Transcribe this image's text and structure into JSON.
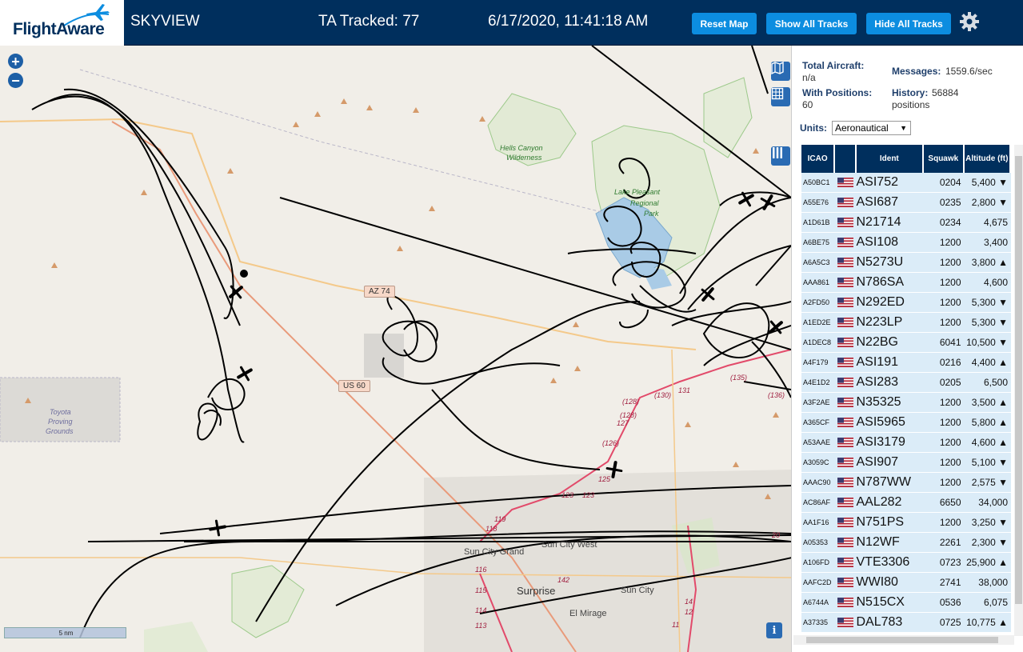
{
  "header": {
    "logo_text": "FlightAware",
    "app_title": "SKYVIEW",
    "tracked": "TA Tracked: 77",
    "clock": "6/17/2020, 11:41:18 AM",
    "buttons": {
      "reset": "Reset Map",
      "show": "Show All Tracks",
      "hide": "Hide All Tracks"
    },
    "colors": {
      "bar": "#002f5d",
      "button": "#0c8de0"
    }
  },
  "map": {
    "zoom_in": "+",
    "zoom_out": "−",
    "info": "i",
    "scale": "5 nm",
    "labels": {
      "hells_canyon": "Hells Canyon",
      "wilderness": "Wilderness",
      "lake": "Lake Pleasant",
      "regional": "Regional",
      "park": "Park",
      "toyota1": "Toyota",
      "toyota2": "Proving",
      "toyota3": "Grounds",
      "az74": "AZ 74",
      "us60": "US 60",
      "sun_city_grand": "Sun City Grand",
      "sun_city_west": "Sun City West",
      "surprise": "Surprise",
      "sun_city": "Sun City",
      "el_mirage": "El Mirage"
    },
    "road_numbers": [
      "(128)",
      "(130)",
      "131",
      "(135)",
      "(136)",
      "(128)",
      "127",
      "(126)",
      "125",
      "123",
      "123",
      "119",
      "118",
      "116",
      "115",
      "114",
      "113",
      "142",
      "14",
      "12",
      "11",
      "20"
    ]
  },
  "panel": {
    "total_label": "Total Aircraft:",
    "total_value": "n/a",
    "messages_label": "Messages:",
    "messages_value": "1559.6/sec",
    "positions_label": "With Positions:",
    "positions_value": "60",
    "history_label": "History:",
    "history_value": "56884",
    "history_unit": "positions",
    "units_label": "Units:",
    "units_value": "Aeronautical",
    "columns": [
      "ICAO",
      "",
      "Ident",
      "Squawk",
      "Altitude (ft)"
    ],
    "rows": [
      {
        "icao": "A50BC1",
        "ident": "ASI752",
        "squawk": "0204",
        "alt": "5,400 ▼"
      },
      {
        "icao": "A55E76",
        "ident": "ASI687",
        "squawk": "0235",
        "alt": "2,800 ▼"
      },
      {
        "icao": "A1D61B",
        "ident": "N21714",
        "squawk": "0234",
        "alt": "4,675"
      },
      {
        "icao": "A6BE75",
        "ident": "ASI108",
        "squawk": "1200",
        "alt": "3,400"
      },
      {
        "icao": "A6A5C3",
        "ident": "N5273U",
        "squawk": "1200",
        "alt": "3,800 ▲"
      },
      {
        "icao": "AAA861",
        "ident": "N786SA",
        "squawk": "1200",
        "alt": "4,600"
      },
      {
        "icao": "A2FD50",
        "ident": "N292ED",
        "squawk": "1200",
        "alt": "5,300 ▼"
      },
      {
        "icao": "A1ED2E",
        "ident": "N223LP",
        "squawk": "1200",
        "alt": "5,300 ▼"
      },
      {
        "icao": "A1DEC8",
        "ident": "N22BG",
        "squawk": "6041",
        "alt": "10,500 ▼"
      },
      {
        "icao": "A4F179",
        "ident": "ASI191",
        "squawk": "0216",
        "alt": "4,400 ▲"
      },
      {
        "icao": "A4E1D2",
        "ident": "ASI283",
        "squawk": "0205",
        "alt": "6,500"
      },
      {
        "icao": "A3F2AE",
        "ident": "N35325",
        "squawk": "1200",
        "alt": "3,500 ▲"
      },
      {
        "icao": "A365CF",
        "ident": "ASI5965",
        "squawk": "1200",
        "alt": "5,800 ▲"
      },
      {
        "icao": "A53AAE",
        "ident": "ASI3179",
        "squawk": "1200",
        "alt": "4,600 ▲"
      },
      {
        "icao": "A3059C",
        "ident": "ASI907",
        "squawk": "1200",
        "alt": "5,100 ▼"
      },
      {
        "icao": "AAAC90",
        "ident": "N787WW",
        "squawk": "1200",
        "alt": "2,575 ▼"
      },
      {
        "icao": "AC86AF",
        "ident": "AAL282",
        "squawk": "6650",
        "alt": "34,000"
      },
      {
        "icao": "AA1F16",
        "ident": "N751PS",
        "squawk": "1200",
        "alt": "3,250 ▼"
      },
      {
        "icao": "A05353",
        "ident": "N12WF",
        "squawk": "2261",
        "alt": "2,300 ▼"
      },
      {
        "icao": "A106FD",
        "ident": "VTE3306",
        "squawk": "0723",
        "alt": "25,900 ▲"
      },
      {
        "icao": "AAFC2D",
        "ident": "WWI80",
        "squawk": "2741",
        "alt": "38,000"
      },
      {
        "icao": "A6744A",
        "ident": "N515CX",
        "squawk": "0536",
        "alt": "6,075"
      },
      {
        "icao": "A37335",
        "ident": "DAL783",
        "squawk": "0725",
        "alt": "10,775 ▲"
      }
    ]
  }
}
